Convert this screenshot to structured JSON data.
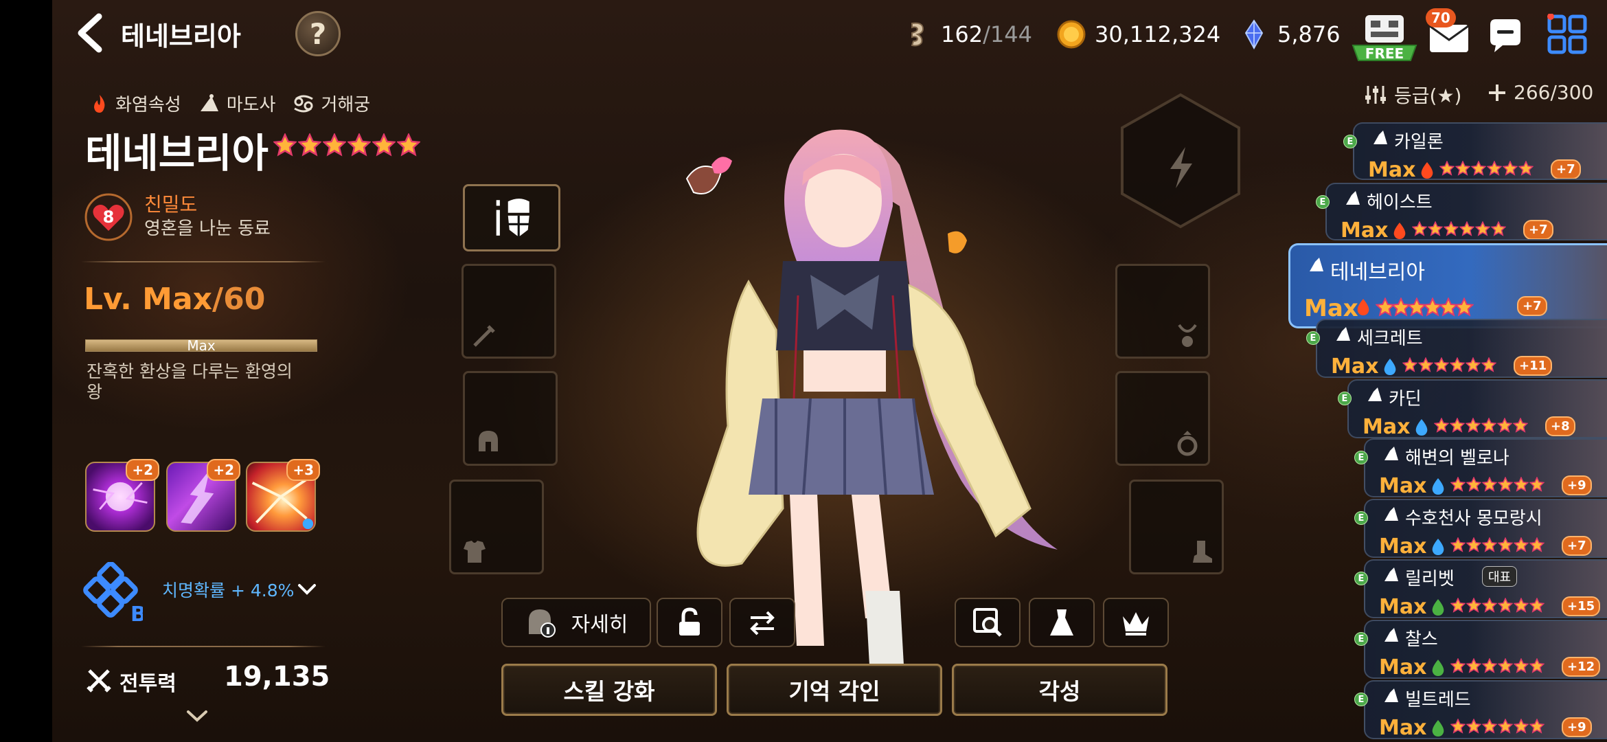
{
  "header": {
    "title": "테네브리아",
    "stamina_current": "162",
    "stamina_max": "/144",
    "gold": "30,112,324",
    "crystals": "5,876",
    "free_label": "FREE",
    "mail_count": "70"
  },
  "hero": {
    "attribute": "화염속성",
    "class": "마도사",
    "zodiac": "거해궁",
    "name": "테네브리아",
    "star_count": 6,
    "bond_level": "8",
    "bond_label": "친밀도",
    "bond_sub": "영혼을 나눈 동료",
    "level_prefix": "Lv. Max",
    "level_cap": "/60",
    "exp_label": "Max",
    "exp_ratio": 1.0,
    "description": "잔혹한 환상을 다루는 환영의 왕",
    "skills": [
      {
        "plus": "+2"
      },
      {
        "plus": "+2"
      },
      {
        "plus": "+3"
      }
    ],
    "set_grade": "B",
    "set_effect": "치명확률 + 4.8%",
    "power_label": "전투력",
    "power_value": "19,135"
  },
  "actions": {
    "detail_label": "자세히",
    "skill_enhance": "스킬 강화",
    "memory_imprint": "기억 각인",
    "awaken": "각성"
  },
  "roster": {
    "sort_label": "등급(★)",
    "count": "266/300",
    "items": [
      {
        "name": "카일론",
        "max": "Max",
        "plus": "+7",
        "element": "fire"
      },
      {
        "name": "헤이스트",
        "max": "Max",
        "plus": "+7",
        "element": "fire"
      },
      {
        "name": "테네브리아",
        "max": "Max",
        "plus": "+7",
        "element": "fire"
      },
      {
        "name": "세크레트",
        "max": "Max",
        "plus": "+11",
        "element": "ice"
      },
      {
        "name": "카딘",
        "max": "Max",
        "plus": "+8",
        "element": "ice"
      },
      {
        "name": "해변의 벨로나",
        "max": "Max",
        "plus": "+9",
        "element": "ice"
      },
      {
        "name": "수호천사 몽모랑시",
        "max": "Max",
        "plus": "+7",
        "element": "ice"
      },
      {
        "name": "릴리벳",
        "max": "Max",
        "plus": "+15",
        "element": "earth",
        "rep": "대표"
      },
      {
        "name": "찰스",
        "max": "Max",
        "plus": "+12",
        "element": "earth"
      },
      {
        "name": "빌트레드",
        "max": "Max",
        "plus": "+9",
        "element": "earth"
      }
    ]
  },
  "colors": {
    "accent_orange": "#ff9b35",
    "selected_card": "#3a76d0",
    "crit_blue": "#5fb7ff"
  }
}
